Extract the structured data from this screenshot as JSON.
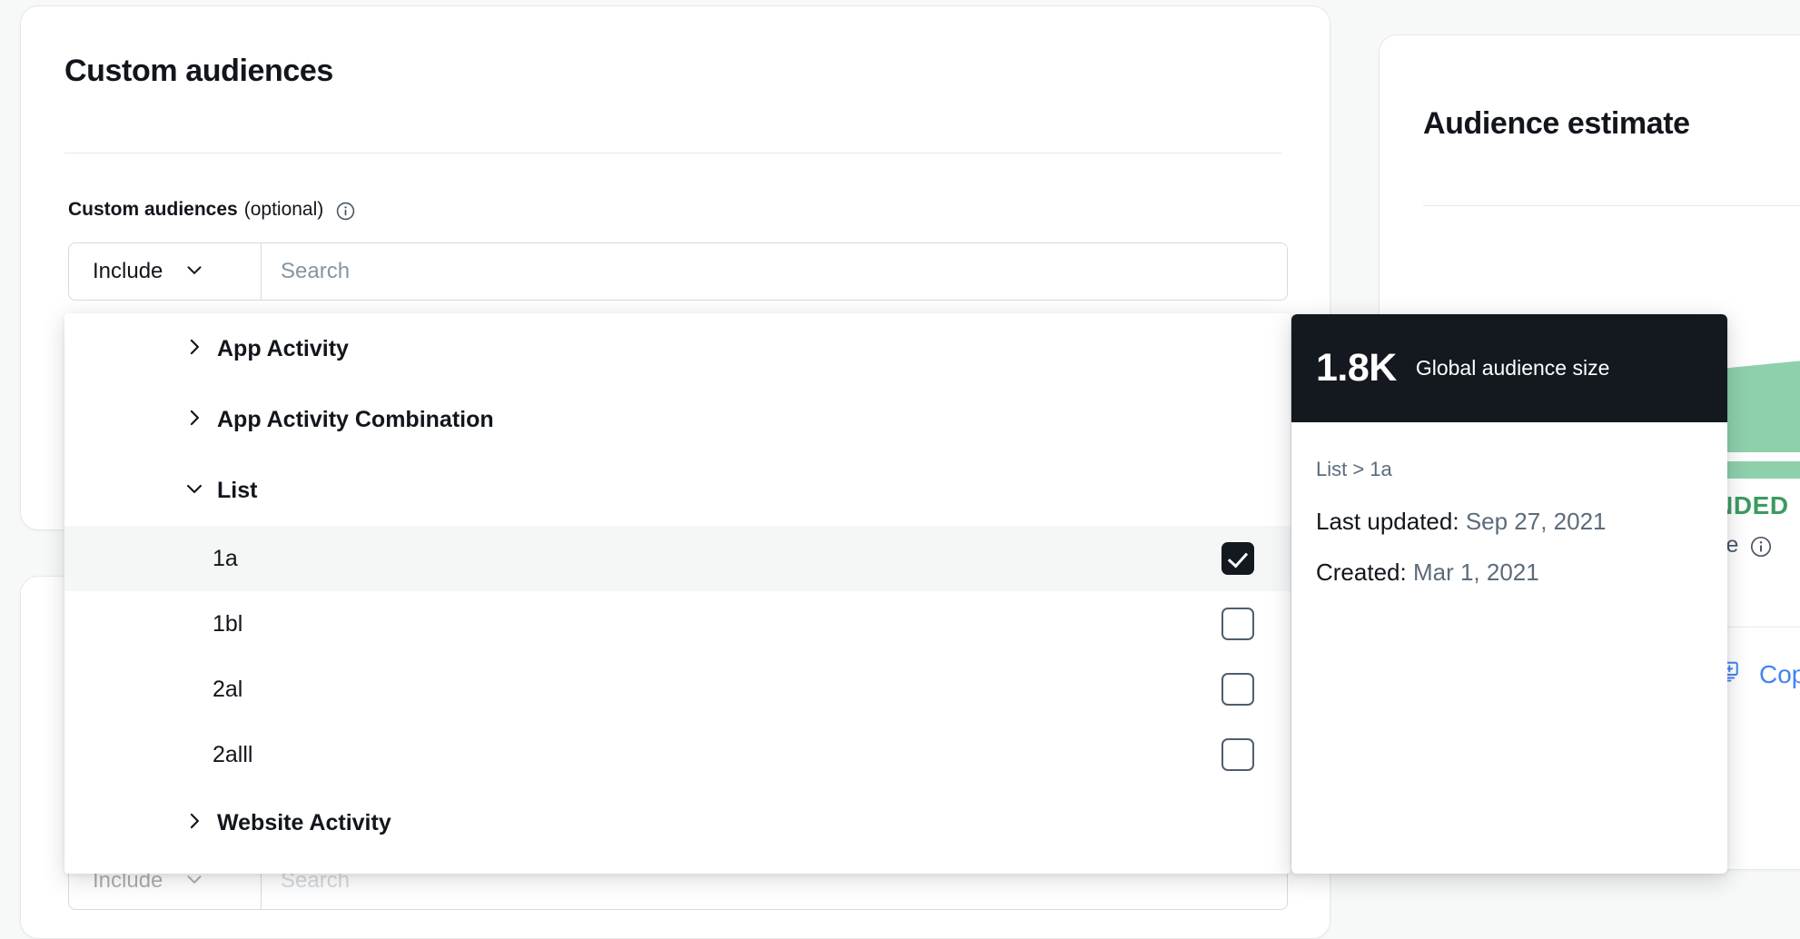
{
  "main_card": {
    "title": "Custom audiences",
    "field": {
      "label_strong": "Custom audiences",
      "label_optional": "(optional)",
      "info_icon": "info-circle-icon"
    },
    "combo": {
      "include_label": "Include",
      "include_chevron_icon": "chevron-down-icon",
      "search_placeholder": "Search",
      "search_value": ""
    }
  },
  "dropdown": {
    "groups": [
      {
        "label": "App Activity",
        "expanded": false,
        "chevron_icon": "chevron-right-icon"
      },
      {
        "label": "App Activity Combination",
        "expanded": false,
        "chevron_icon": "chevron-right-icon"
      },
      {
        "label": "List",
        "expanded": true,
        "chevron_icon": "chevron-down-icon"
      }
    ],
    "list_items": [
      {
        "label": "1a",
        "checked": true,
        "highlighted": true
      },
      {
        "label": "1bl",
        "checked": false,
        "highlighted": false
      },
      {
        "label": "2al",
        "checked": false,
        "highlighted": false
      },
      {
        "label": "2alll",
        "checked": false,
        "highlighted": false
      }
    ],
    "trailing_groups": [
      {
        "label": "Website Activity",
        "expanded": false,
        "chevron_icon": "chevron-right-icon"
      }
    ]
  },
  "tooltip": {
    "size_value": "1.8K",
    "size_caption": "Global audience size",
    "path": "List > 1a",
    "rows": [
      {
        "label": "Last updated:",
        "value": "Sep 27, 2021"
      },
      {
        "label": "Created:",
        "value": "Mar 1, 2021"
      }
    ]
  },
  "estimate_card": {
    "title": "Audience estimate",
    "recommended_label": "NDED",
    "size_caption": "ze",
    "size_caption_info_icon": "info-circle-icon",
    "copy": {
      "icon": "copy-add-icon",
      "label": "Cop"
    }
  },
  "ghost_row": {
    "include_label": "Include",
    "search_placeholder": "Search"
  },
  "colors": {
    "page_background": "#f7f8f8",
    "card_background": "#ffffff",
    "card_border": "#e6e8ea",
    "text_primary": "#12161c",
    "text_muted": "#5c6b7a",
    "placeholder": "#8794a1",
    "tooltip_header": "#14181f",
    "checkbox_checked": "#14181f",
    "checkbox_border": "#4f5d6e",
    "row_highlight": "#f5f7f7",
    "gauge_green": "#8fd0ac",
    "recommended_green": "#3d9a62",
    "link_blue": "#4184f3"
  }
}
